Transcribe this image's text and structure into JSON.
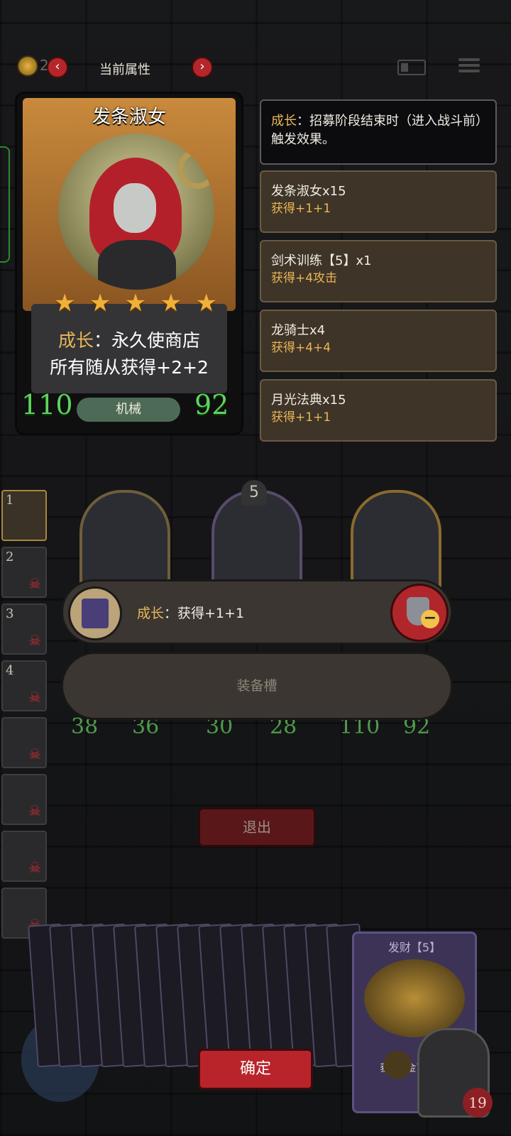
{
  "topbar": {
    "title": "当前属性",
    "gold_value": "27",
    "prev_icon": "chevron-left-icon",
    "next_icon": "chevron-right-icon"
  },
  "hero_card": {
    "name": "发条淑女",
    "stars": 5,
    "desc_keyword": "成长",
    "desc_line1_rest": "：永久使商店",
    "desc_line2": "所有随从获得+2+2",
    "attack": "110",
    "health": "92",
    "tribe": "机械"
  },
  "info": {
    "keyword": "成长",
    "text": "：招募阶段结束时（进入战斗前）触发效果。"
  },
  "effects": [
    {
      "title": "发条淑女x15",
      "value": "获得+1+1"
    },
    {
      "title": "剑术训练【5】x1",
      "value": "获得+4攻击"
    },
    {
      "title": "龙骑士x4",
      "value": "获得+4+4"
    },
    {
      "title": "月光法典x15",
      "value": "获得+1+1"
    }
  ],
  "roster": [
    "1",
    "2",
    "3",
    "4",
    "",
    "",
    "",
    ""
  ],
  "board": {
    "tier": "5",
    "stats": [
      {
        "atk": "38",
        "hp": "36"
      },
      {
        "atk": "30",
        "hp": "28"
      },
      {
        "atk": "110",
        "hp": "92"
      }
    ]
  },
  "equipment": {
    "keyword": "成长",
    "text": "：获得+1+1",
    "empty_slot_label": "装备槽"
  },
  "buttons": {
    "exit": "退出",
    "confirm": "确定"
  },
  "feature_card": {
    "name": "发财【5】",
    "desc": "获得2金币 金色"
  },
  "hero": {
    "hp": "19"
  },
  "colors": {
    "keyword": "#e7b85a",
    "stat_green": "#5ed35e",
    "button_red": "#b8242a"
  }
}
